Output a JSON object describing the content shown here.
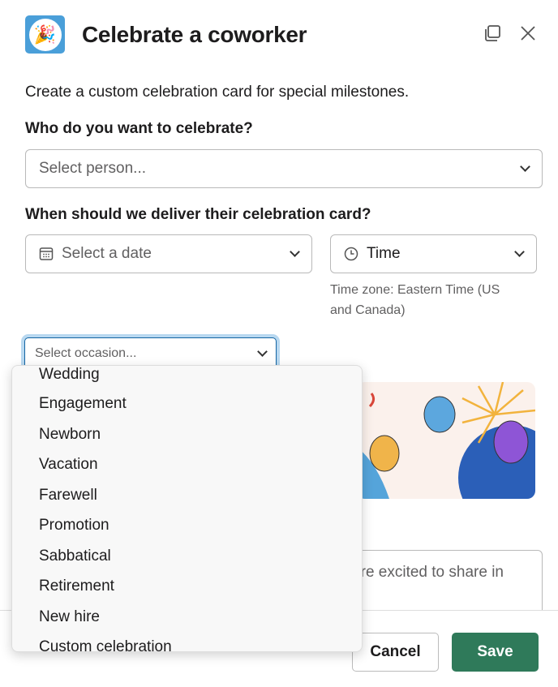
{
  "header": {
    "title": "Celebrate a coworker",
    "logo_emoji": "🎉"
  },
  "description": "Create a custom celebration card for special milestones.",
  "person": {
    "label": "Who do you want to celebrate?",
    "placeholder": "Select person..."
  },
  "delivery": {
    "label": "When should we deliver their celebration card?",
    "date_placeholder": "Select a date",
    "time_placeholder": "Time",
    "timezone_hint": "Time zone: Eastern Time (US and Canada)"
  },
  "occasion": {
    "placeholder": "Select occasion...",
    "options": [
      "Wedding",
      "Engagement",
      "Newborn",
      "Vacation",
      "Farewell",
      "Promotion",
      "Sabbatical",
      "Retirement",
      "New hire",
      "Custom celebration"
    ]
  },
  "message": {
    "partial_text": "'re excited to share in"
  },
  "footer": {
    "cancel": "Cancel",
    "save": "Save"
  },
  "colors": {
    "save": "#2f7a5a",
    "focus": "#1264a3"
  }
}
